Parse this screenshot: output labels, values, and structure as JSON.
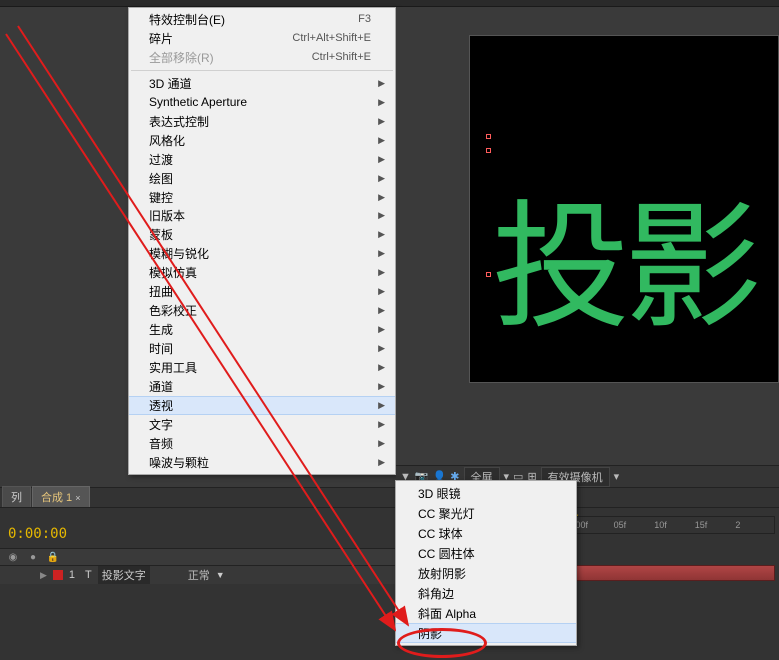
{
  "menu": {
    "items": [
      {
        "label": "特效控制台(E)",
        "shortcut": "F3"
      },
      {
        "label": "碎片",
        "shortcut": "Ctrl+Alt+Shift+E"
      },
      {
        "label": "全部移除(R)",
        "shortcut": "Ctrl+Shift+E",
        "disabled": true
      }
    ],
    "sub_items": [
      "3D 通道",
      "Synthetic Aperture",
      "表达式控制",
      "风格化",
      "过渡",
      "绘图",
      "键控",
      "旧版本",
      "蒙板",
      "模糊与锐化",
      "模拟仿真",
      "扭曲",
      "色彩校正",
      "生成",
      "时间",
      "实用工具",
      "通道",
      "透视",
      "文字",
      "音频",
      "噪波与颗粒"
    ],
    "highlight_index": 17
  },
  "submenu": {
    "items": [
      "3D 眼镜",
      "CC 聚光灯",
      "CC 球体",
      "CC 圆柱体",
      "放射阴影",
      "斜角边",
      "斜面 Alpha",
      "阴影"
    ],
    "highlight_index": 7
  },
  "preview": {
    "text": "投影"
  },
  "timeline": {
    "tabs": [
      "列",
      "合成 1"
    ],
    "timecode": "0:00:00",
    "layer_index": "1",
    "layer_name": "投影文字",
    "blend_mode": "正常",
    "ruler": [
      ":00f",
      "05f",
      "10f",
      "15f",
      "2"
    ]
  },
  "playbar": {
    "label_full": "全屏",
    "label_cam": "有效摄像机"
  }
}
